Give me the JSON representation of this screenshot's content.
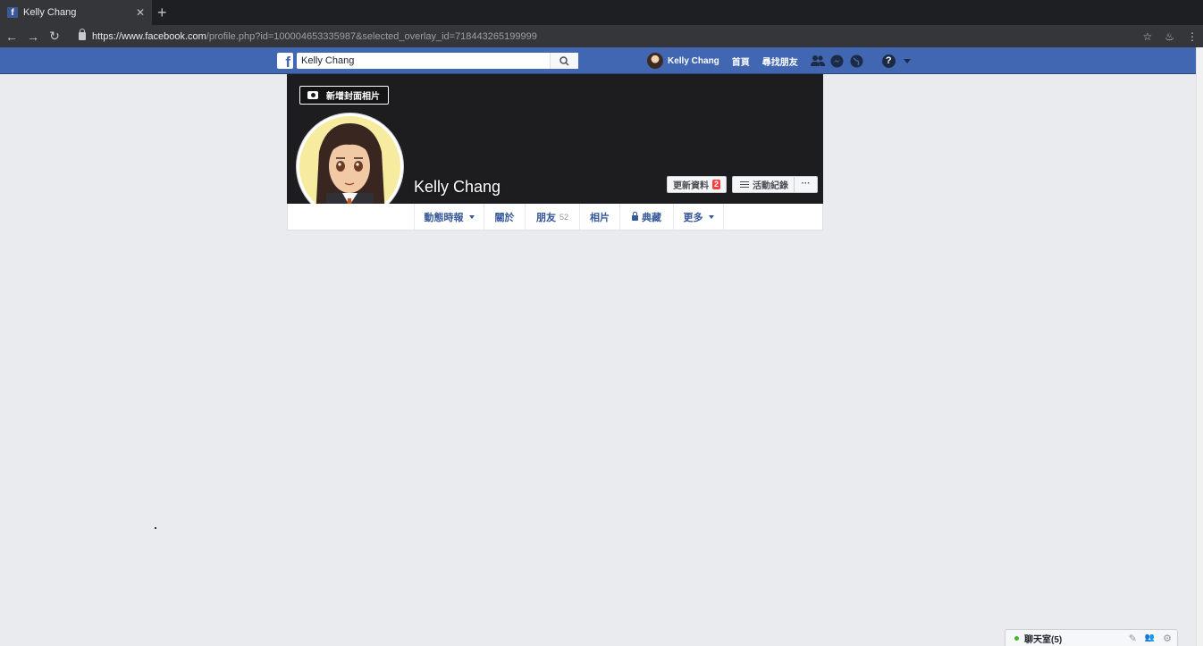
{
  "browser": {
    "tab_title": "Kelly Chang",
    "favicon": "f",
    "close_glyph": "✕",
    "new_tab_glyph": "+",
    "back_glyph": "←",
    "forward_glyph": "→",
    "reload_glyph": "↻",
    "url_host": "https://www.facebook.com",
    "url_path": "/profile.php?id=100004653335987&selected_overlay_id=718443265199999",
    "star_glyph": "☆",
    "extension_glyph": "♨",
    "menu_glyph": "⋮"
  },
  "fb_header": {
    "logo": "f",
    "search_value": "Kelly Chang",
    "user_name": "Kelly Chang",
    "nav_home": "首頁",
    "nav_find_friends": "尋找朋友",
    "help_glyph": "?"
  },
  "profile": {
    "add_cover_label": "新增封面相片",
    "name": "Kelly Chang",
    "update_info_label": "更新資料",
    "update_badge": "2",
    "activity_log_label": "活動紀錄",
    "more_glyph": "···"
  },
  "tabs": {
    "timeline": "動態時報",
    "about": "關於",
    "friends": "朋友",
    "friends_count": "52",
    "photos": "相片",
    "archive": "典藏",
    "more": "更多"
  },
  "chat": {
    "label": "聊天室(5)",
    "compose_glyph": "✎",
    "group_glyph": "👥",
    "settings_glyph": "⚙"
  },
  "colors": {
    "fb_blue": "#4267b2",
    "link_blue": "#365899",
    "page_bg": "#e9ebee",
    "cover_bg": "#1d1d1f"
  }
}
